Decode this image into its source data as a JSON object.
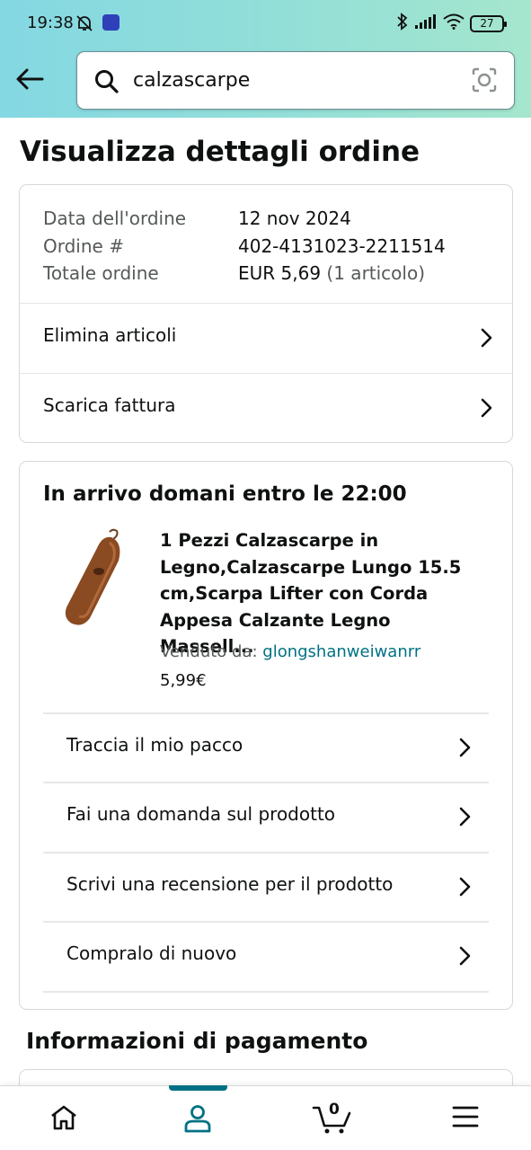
{
  "status_bar": {
    "time": "19:38",
    "battery": "27",
    "icons": [
      "mute-bell-icon",
      "nexi-app-icon",
      "bluetooth-icon",
      "signal-icon",
      "wifi-icon",
      "battery-icon"
    ]
  },
  "header": {
    "search_value": "calzascarpe",
    "icons": [
      "back-arrow-icon",
      "search-icon",
      "camera-scan-icon"
    ]
  },
  "page": {
    "title": "Visualizza dettagli ordine"
  },
  "order_summary": {
    "date_label": "Data dell'ordine",
    "date_value": "12 nov 2024",
    "number_label": "Ordine #",
    "number_value": "402-4131023-2211514",
    "total_label": "Totale ordine",
    "total_value": "EUR 5,69",
    "total_items": "(1 articolo)",
    "links": [
      {
        "label": "Elimina articoli"
      },
      {
        "label": "Scarica fattura"
      }
    ]
  },
  "shipment": {
    "heading": "In arrivo domani entro le 22:00",
    "product_title": "1 Pezzi Calzascarpe in Legno,Calzascarpe Lungo 15.5 cm,Scarpa Lifter con Corda Appesa Calzante Legno Massell...",
    "seller_label": "Venduto da: ",
    "seller_name": "glongshanweiwanrr",
    "price": "5,99€",
    "actions": [
      {
        "label": "Traccia il mio pacco"
      },
      {
        "label": "Fai una domanda sul prodotto"
      },
      {
        "label": "Scrivi una recensione per il prodotto"
      },
      {
        "label": "Compralo di nuovo"
      }
    ]
  },
  "payment": {
    "heading": "Informazioni di pagamento"
  },
  "bottom_nav": {
    "cart_count": "0",
    "items": [
      "home-icon",
      "account-icon",
      "cart-icon",
      "menu-icon"
    ],
    "active": "account-icon",
    "accent_color": "#007185"
  }
}
